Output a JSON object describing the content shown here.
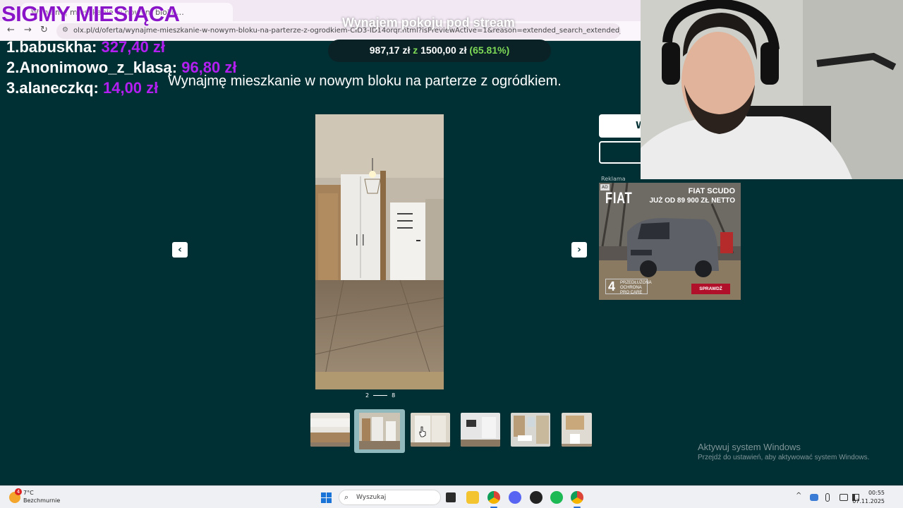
{
  "browser": {
    "tab_title": "Wynajmę mieszkanie w nowym bloku…",
    "url": "olx.pl/d/oferta/wynajme-mieszkanie-w-nowym-bloku-na-parterze-z-ogrodkiem-CID3-ID14orqr.html?isPreviewActive=1&reason=extended_search_extended_distance&sliderIndex=7",
    "back_icon": "←",
    "forward_icon": "→",
    "reload_icon": "↻",
    "site_icon": "⚙"
  },
  "overlay": {
    "banner": "SIGMY MIESIĄCA",
    "stream_title": "Wynajem pokoju pod stream",
    "goal": {
      "current": "987,17 zł",
      "sep": "z",
      "target": "1500,00 zł",
      "percent": "(65.81%)",
      "progress": 0.6581
    },
    "donors": [
      {
        "rank": "1.",
        "name": "babuskha:",
        "amount": "327,40 zł"
      },
      {
        "rank": "2.",
        "name": "Anonimowo_z_klasą:",
        "amount": "96,80 zł"
      },
      {
        "rank": "3.",
        "name": "alaneczkq:",
        "amount": "14,00 zł"
      }
    ]
  },
  "offer": {
    "title": "Wynajmę mieszkanie w nowym bloku na parterze z ogródkiem.",
    "gallery": {
      "current": "2",
      "total": "8",
      "prev_icon": "‹",
      "next_icon": "›",
      "thumbnails": [
        "kitchen",
        "hallway",
        "wardrobe",
        "room",
        "bathroom",
        "toilet"
      ],
      "active_index": 1
    },
    "side_button_1": "W"
  },
  "ad": {
    "label": "Reklama",
    "badge": "AD",
    "brand": "FIAT",
    "model": "FIAT SCUDO",
    "price": "JUŻ OD 89 900 ZŁ NETTO",
    "pro_number": "4",
    "pro_text": "PRZEDŁUŻONA OCHRONA PRO CARE",
    "cta": "SPRAWDŹ"
  },
  "windows_watermark": {
    "line1": "Aktywuj system Windows",
    "line2": "Przejdź do ustawień, aby aktywować system Windows."
  },
  "taskbar": {
    "weather_badge": "4",
    "temperature": "7°C",
    "weather": "Bezchmurnie",
    "search_placeholder": "Wyszukaj",
    "search_icon": "⌕",
    "tray_chevron": "^",
    "time": "00:55",
    "date": "07.11.2025",
    "colors": {
      "accent": "#1a74d8",
      "spotify": "#1db954",
      "chrome": "#db4437"
    }
  }
}
